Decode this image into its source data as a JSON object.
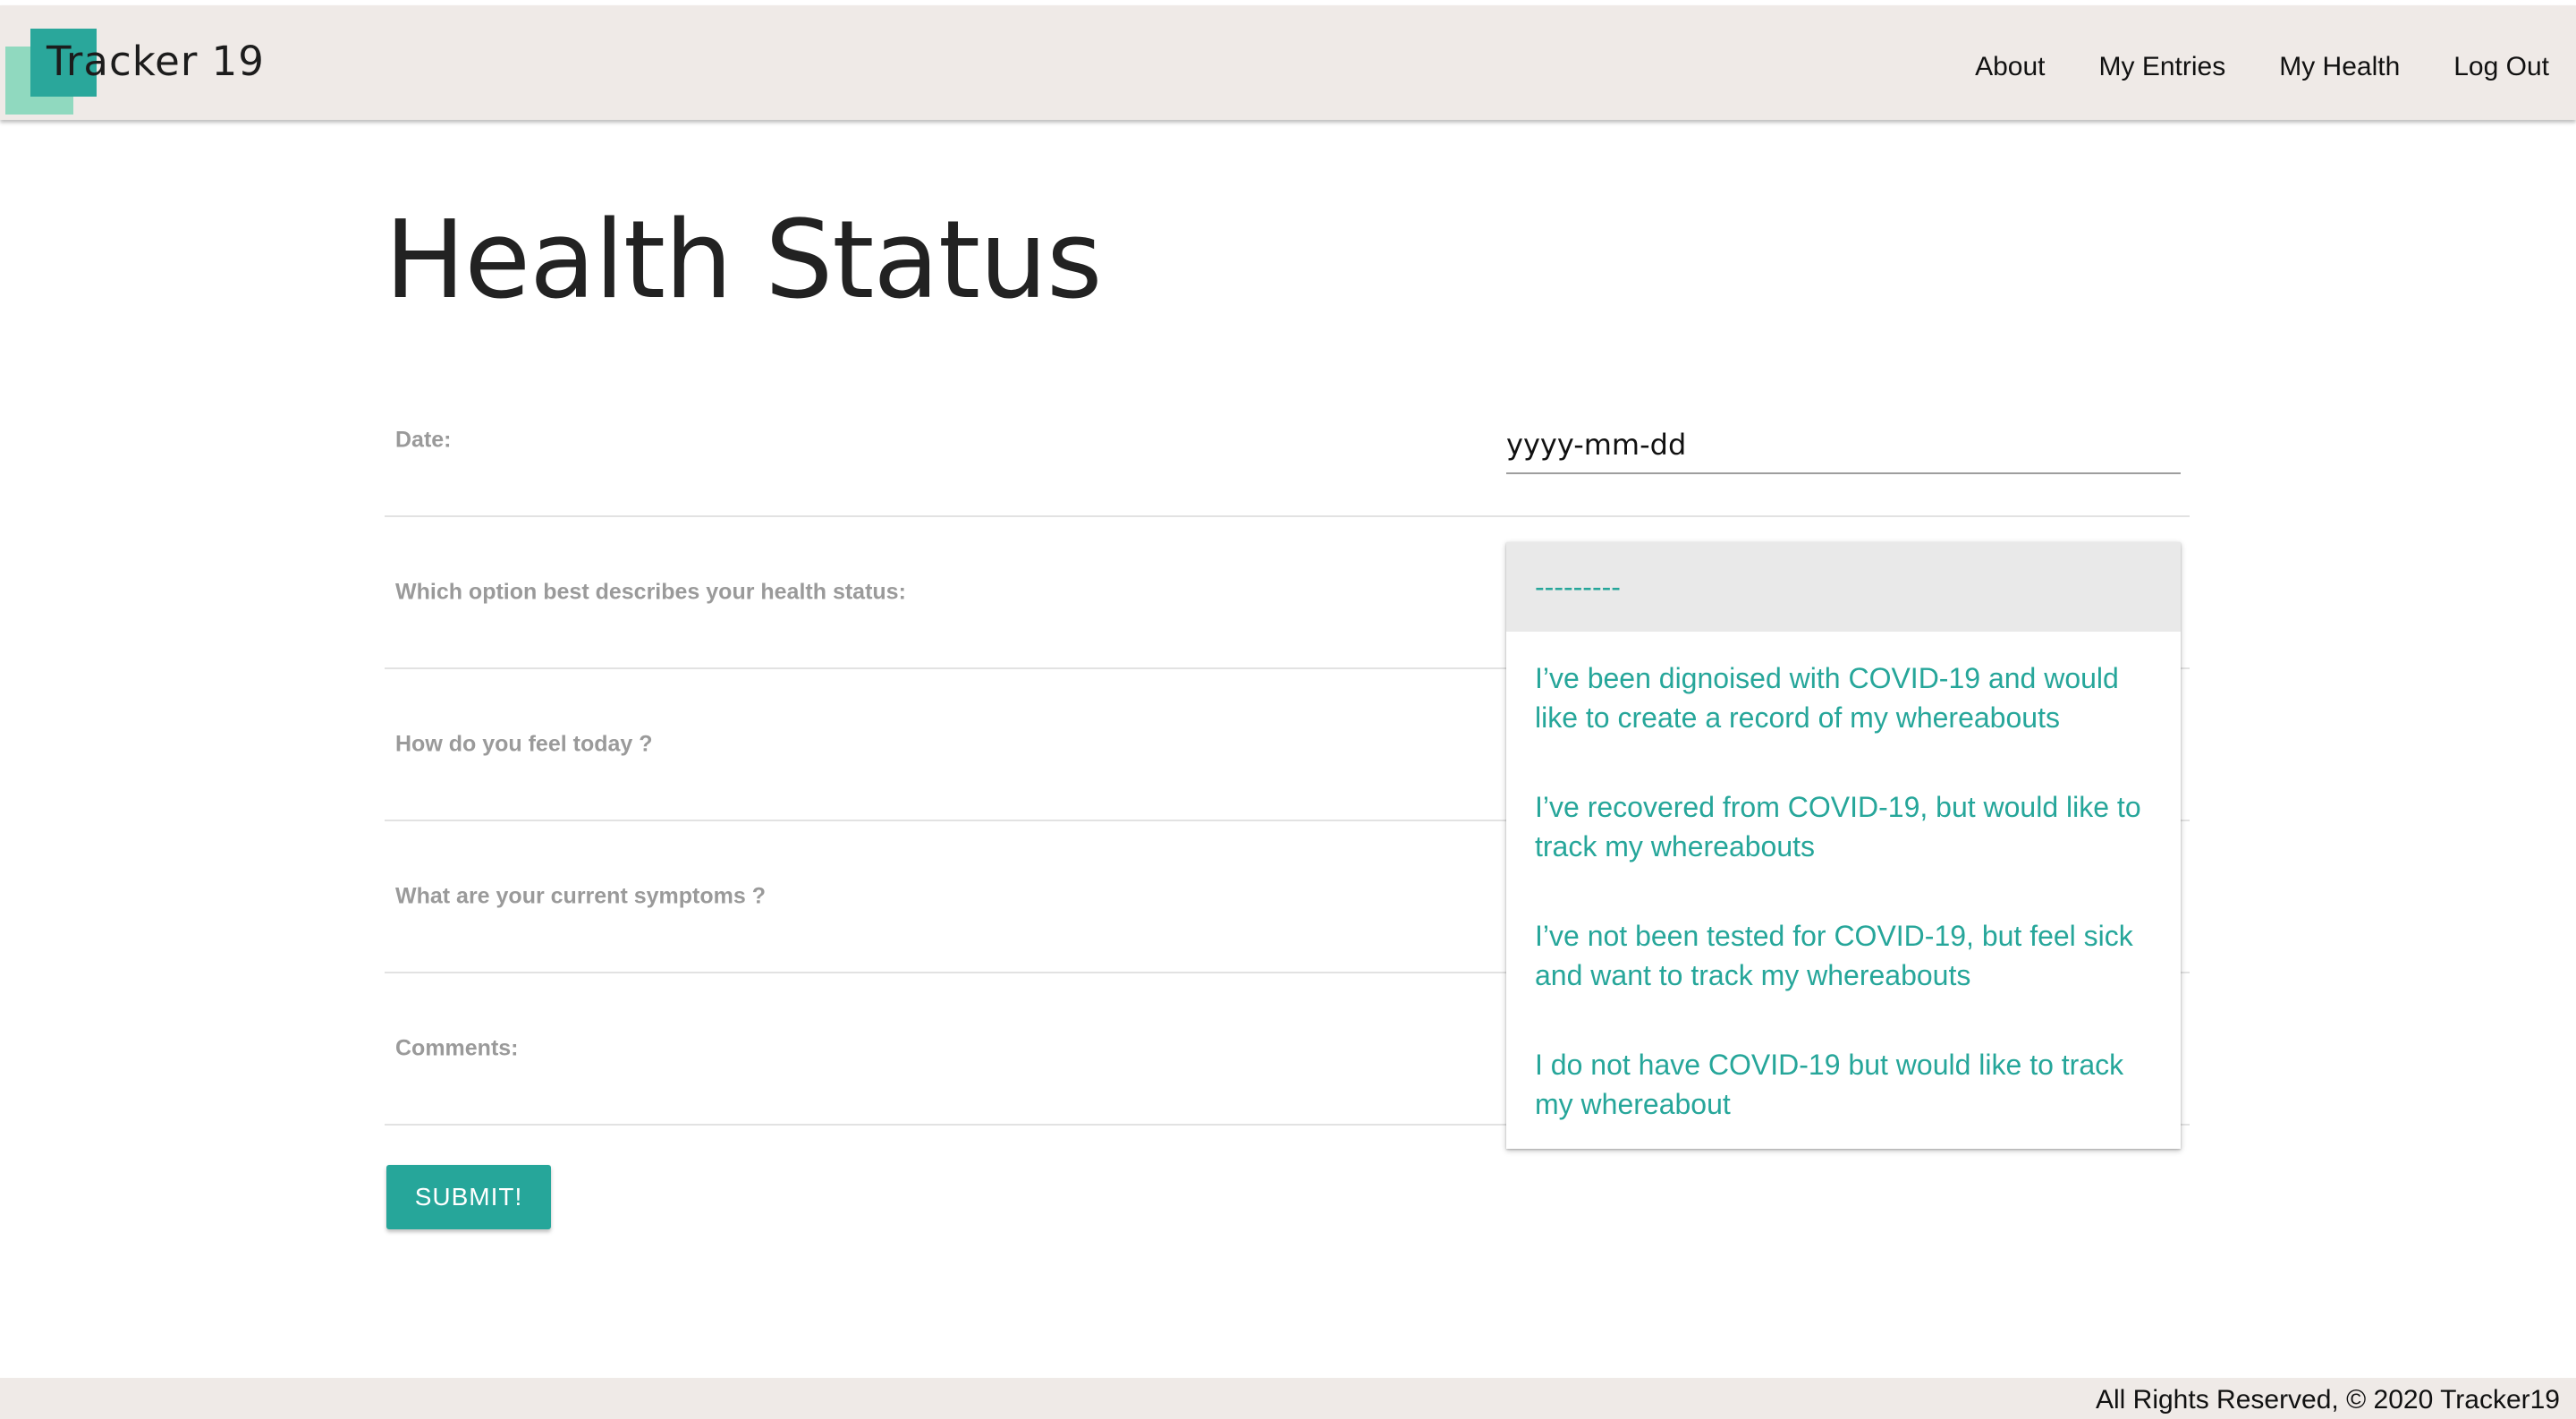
{
  "nav": {
    "brand": "Tracker 19",
    "links": [
      "About",
      "My Entries",
      "My Health",
      "Log Out"
    ]
  },
  "page": {
    "title": "Health Status"
  },
  "form": {
    "date_label": "Date:",
    "date_placeholder": "yyyy-mm-dd",
    "status_label": "Which option best describes your health status:",
    "feel_label": "How do you feel today ?",
    "symptoms_label": "What are your current symptoms ?",
    "comments_label": "Comments:",
    "submit_label": "SUBMIT!"
  },
  "dropdown": {
    "selected": "---------",
    "options": [
      "I’ve been dignoised with COVID-19 and would like to create a record of my whereabouts",
      "I’ve recovered from COVID-19, but would like to track my whereabouts",
      "I’ve not been tested for COVID-19, but feel sick and want to track my whereabouts",
      "I do not have COVID-19 but would like to track my whereabout"
    ]
  },
  "footer": {
    "text": "All Rights Reserved, © 2020 Tracker19"
  },
  "colors": {
    "accent": "#26a69a",
    "navbar_bg": "#efeae7",
    "logo_light": "#8ad8bd"
  }
}
